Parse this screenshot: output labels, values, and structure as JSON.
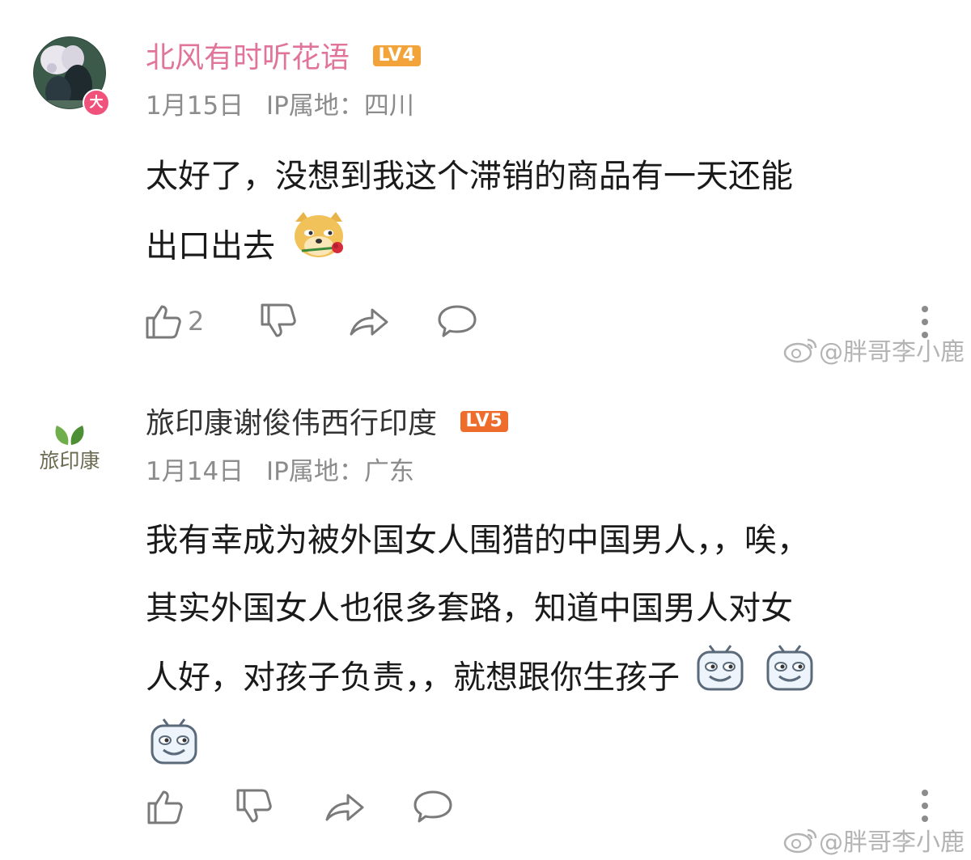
{
  "comments": [
    {
      "username": "北风有时听花语",
      "level": "LV4",
      "badge": "大",
      "date": "1月15日",
      "ip_location": "IP属地：四川",
      "content_lines": [
        "太好了，没想到我这个滞销的商品有一天还能",
        "出口出去"
      ],
      "like_count": "2",
      "watermark": "@胖哥李小鹿",
      "colors": {
        "username": "#e0749a",
        "level_bg": "#f2a43a"
      }
    },
    {
      "username": "旅印康谢俊伟西行印度",
      "level": "LV5",
      "avatar_text": "旅印康",
      "date": "1月14日",
      "ip_location": "IP属地：广东",
      "content_lines": [
        "我有幸成为被外国女人围猎的中国男人，，唉，",
        "其实外国女人也很多套路，知道中国男人对女",
        "人好，对孩子负责，，就想跟你生孩子"
      ],
      "watermark": "@胖哥李小鹿",
      "colors": {
        "username": "#333333",
        "level_bg": "#ee6d2c"
      }
    }
  ],
  "icons": [
    "like-icon",
    "dislike-icon",
    "share-icon",
    "reply-icon",
    "more-icon",
    "weibo-icon",
    "doge-rose-emoji",
    "grin-tv-emoji"
  ]
}
